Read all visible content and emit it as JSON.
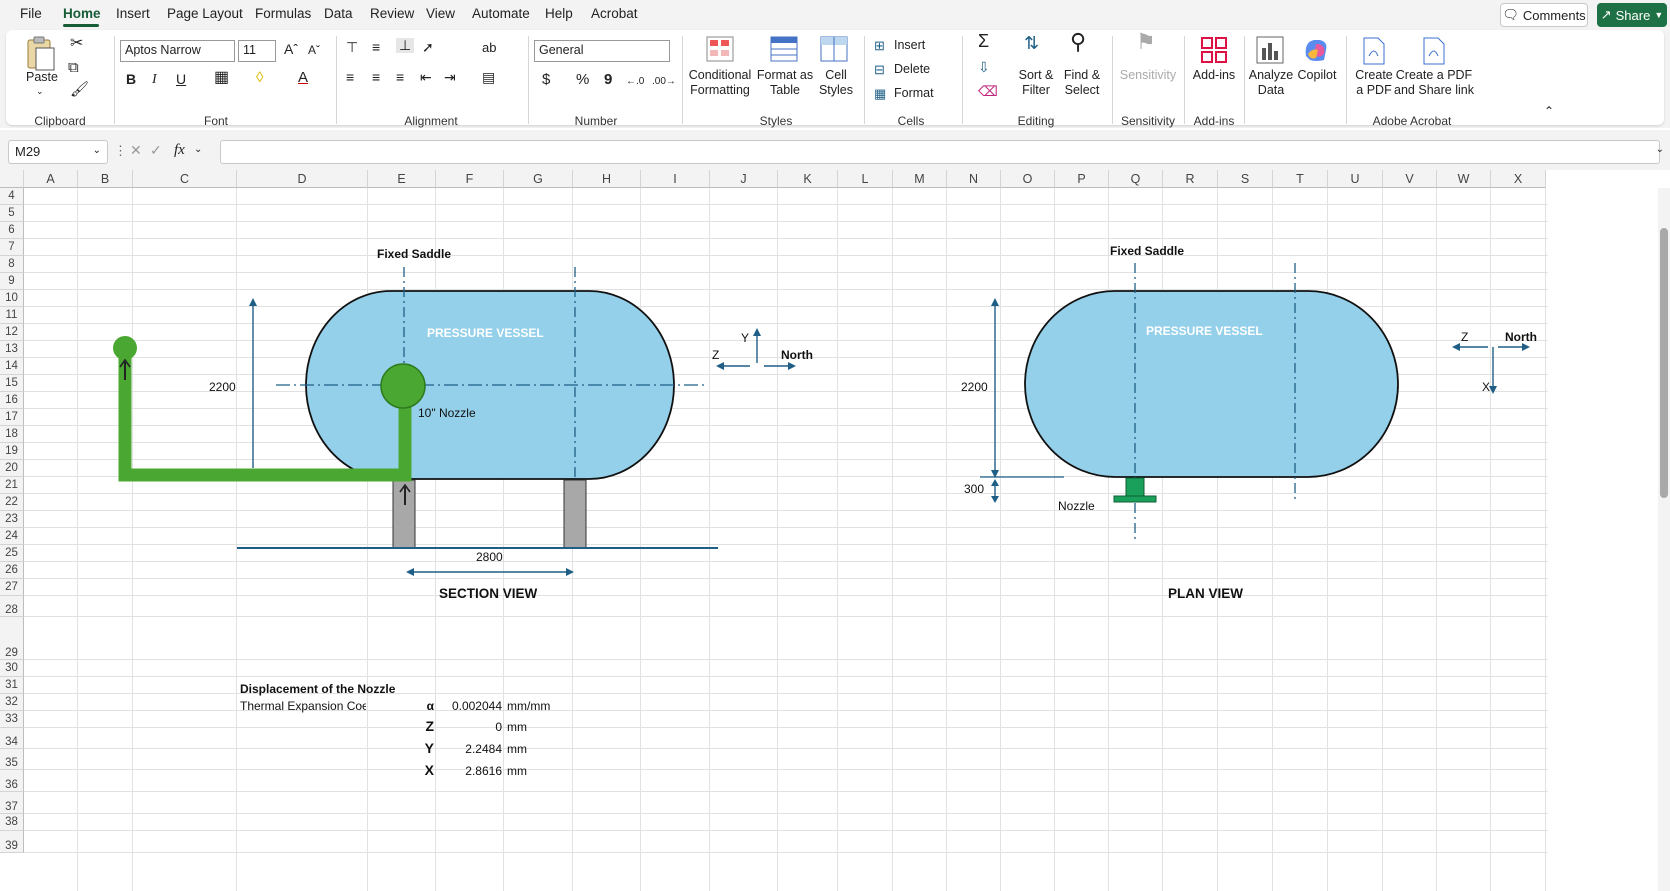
{
  "menu": {
    "items": [
      "File",
      "Home",
      "Insert",
      "Page Layout",
      "Formulas",
      "Data",
      "Review",
      "View",
      "Automate",
      "Help",
      "Acrobat"
    ],
    "active": "Home",
    "comments_label": "Comments",
    "share_label": "Share"
  },
  "ribbon": {
    "clipboard": {
      "paste": "Paste",
      "group": "Clipboard"
    },
    "font": {
      "name": "Aptos Narrow",
      "size": "11",
      "group": "Font",
      "bold": "B",
      "italic": "I",
      "underline": "U"
    },
    "alignment": {
      "group": "Alignment"
    },
    "number": {
      "format": "General",
      "group": "Number",
      "currency": "$",
      "percent": "%",
      "comma": "9"
    },
    "styles": {
      "conditional": "Conditional",
      "conditional2": "Formatting",
      "table": "Format as",
      "table2": "Table",
      "cell": "Cell",
      "cell2": "Styles",
      "group": "Styles"
    },
    "cells": {
      "insert": "Insert",
      "delete": "Delete",
      "format": "Format",
      "group": "Cells"
    },
    "editing": {
      "sort": "Sort &",
      "sort2": "Filter",
      "find": "Find &",
      "find2": "Select",
      "group": "Editing"
    },
    "sensitivity": {
      "label": "Sensitivity",
      "group": "Sensitivity"
    },
    "addins": {
      "label": "Add-ins",
      "group": "Add-ins"
    },
    "analyze": {
      "label": "Analyze",
      "label2": "Data"
    },
    "copilot": {
      "label": "Copilot"
    },
    "acrobat": {
      "create": "Create",
      "create2": "a PDF",
      "share": "Create a PDF",
      "share2": "and Share link",
      "group": "Adobe Acrobat"
    }
  },
  "formula_bar": {
    "name_box": "M29",
    "fx": "fx",
    "value": ""
  },
  "columns": [
    "A",
    "B",
    "C",
    "D",
    "E",
    "F",
    "G",
    "H",
    "I",
    "J",
    "K",
    "L",
    "M",
    "N",
    "O",
    "P",
    "Q",
    "R",
    "S",
    "T",
    "U",
    "V",
    "W",
    "X"
  ],
  "rows": [
    "4",
    "5",
    "6",
    "7",
    "8",
    "9",
    "10",
    "11",
    "12",
    "13",
    "14",
    "15",
    "16",
    "17",
    "18",
    "19",
    "20",
    "21",
    "22",
    "23",
    "24",
    "25",
    "26",
    "27",
    "28",
    "29",
    "30",
    "31",
    "32",
    "33",
    "34",
    "35",
    "36",
    "37",
    "38",
    "39"
  ],
  "drawing": {
    "section": {
      "fixed_saddle": "Fixed Saddle",
      "vessel_label": "PRESSURE VESSEL",
      "height_dim": "2200",
      "nozzle_label": "10\" Nozzle",
      "span_dim": "2800",
      "title": "SECTION VIEW",
      "axis_y": "Y",
      "axis_z": "Z",
      "axis_north": "North"
    },
    "plan": {
      "fixed_saddle": "Fixed Saddle",
      "vessel_label": "PRESSURE VESSEL",
      "height_dim": "2200",
      "offset_dim": "300",
      "nozzle_label": "Nozzle",
      "title": "PLAN VIEW",
      "axis_z": "Z",
      "axis_x": "X",
      "axis_north": "North"
    }
  },
  "table": {
    "heading": "Displacement of the Nozzle",
    "rows": [
      {
        "label": "Thermal Expansion Coeffi",
        "sym": "α",
        "value": "0.002044",
        "unit": "mm/mm"
      },
      {
        "label": "",
        "sym": "Z",
        "value": "0",
        "unit": "mm"
      },
      {
        "label": "",
        "sym": "Y",
        "value": "2.2484",
        "unit": "mm"
      },
      {
        "label": "",
        "sym": "X",
        "value": "2.8616",
        "unit": "mm"
      }
    ]
  },
  "colors": {
    "vessel": "#94d0ea",
    "pipe": "#4aa832",
    "nozzle_plan": "#1aa05a",
    "dim": "#1f5f86",
    "brand": "#185c37"
  }
}
